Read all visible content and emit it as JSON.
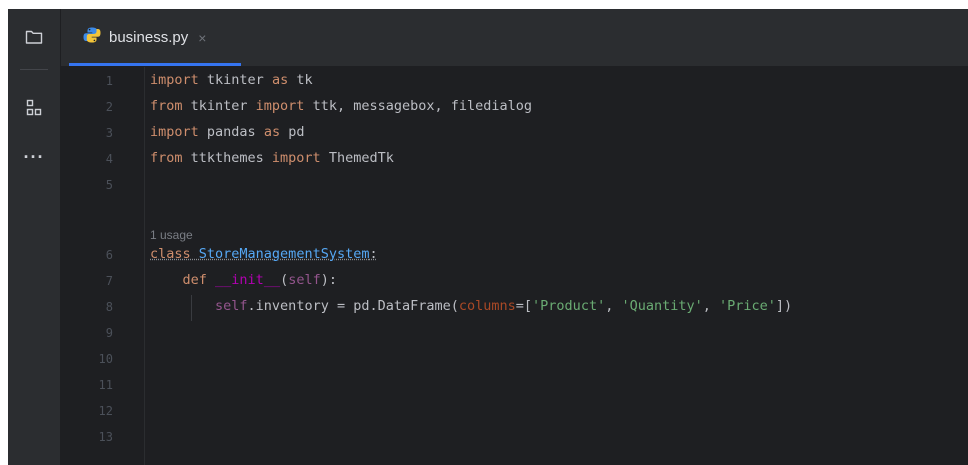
{
  "activity_bar": {
    "items": [
      {
        "name": "project",
        "icon": "folder-icon"
      },
      {
        "name": "structure",
        "icon": "structure-icon"
      },
      {
        "name": "more",
        "icon": "more-dots-icon",
        "label": "···"
      }
    ]
  },
  "tab": {
    "label": "business.py",
    "close": "×",
    "icon": "python-file-icon"
  },
  "editor": {
    "line_numbers": [
      "1",
      "2",
      "3",
      "4",
      "5",
      "6",
      "7",
      "8",
      "9",
      "10",
      "11",
      "12",
      "13"
    ],
    "inlay_hint": "1 usage",
    "code": {
      "l1": {
        "k1": "import",
        "t1": " tkinter ",
        "k2": "as",
        "t2": " tk"
      },
      "l2": {
        "k1": "from",
        "t1": " tkinter ",
        "k2": "import",
        "t2": " ttk, messagebox, filedialog"
      },
      "l3": {
        "k1": "import",
        "t1": " pandas ",
        "k2": "as",
        "t2": " pd"
      },
      "l4": {
        "k1": "from",
        "t1": " ttkthemes ",
        "k2": "import",
        "t2": " ThemedTk"
      },
      "l6": {
        "k1": "class",
        "t1": " ",
        "name": "StoreManagementSystem",
        "t2": ":"
      },
      "l7": {
        "k1": "def",
        "t1": " ",
        "name": "__init__",
        "p1": "(",
        "self": "self",
        "p2": "):"
      },
      "l8": {
        "self": "self",
        "t1": ".inventory = pd.DataFrame(",
        "param": "columns",
        "t2": "=[",
        "s1": "'Product'",
        "c1": ", ",
        "s2": "'Quantity'",
        "c2": ", ",
        "s3": "'Price'",
        "t3": "])"
      }
    }
  },
  "colors": {
    "background": "#1e1f22",
    "keyword": "#cf8e6d",
    "function": "#56a8f5",
    "string": "#6aab73",
    "self": "#94558d",
    "accent": "#3574f0"
  }
}
